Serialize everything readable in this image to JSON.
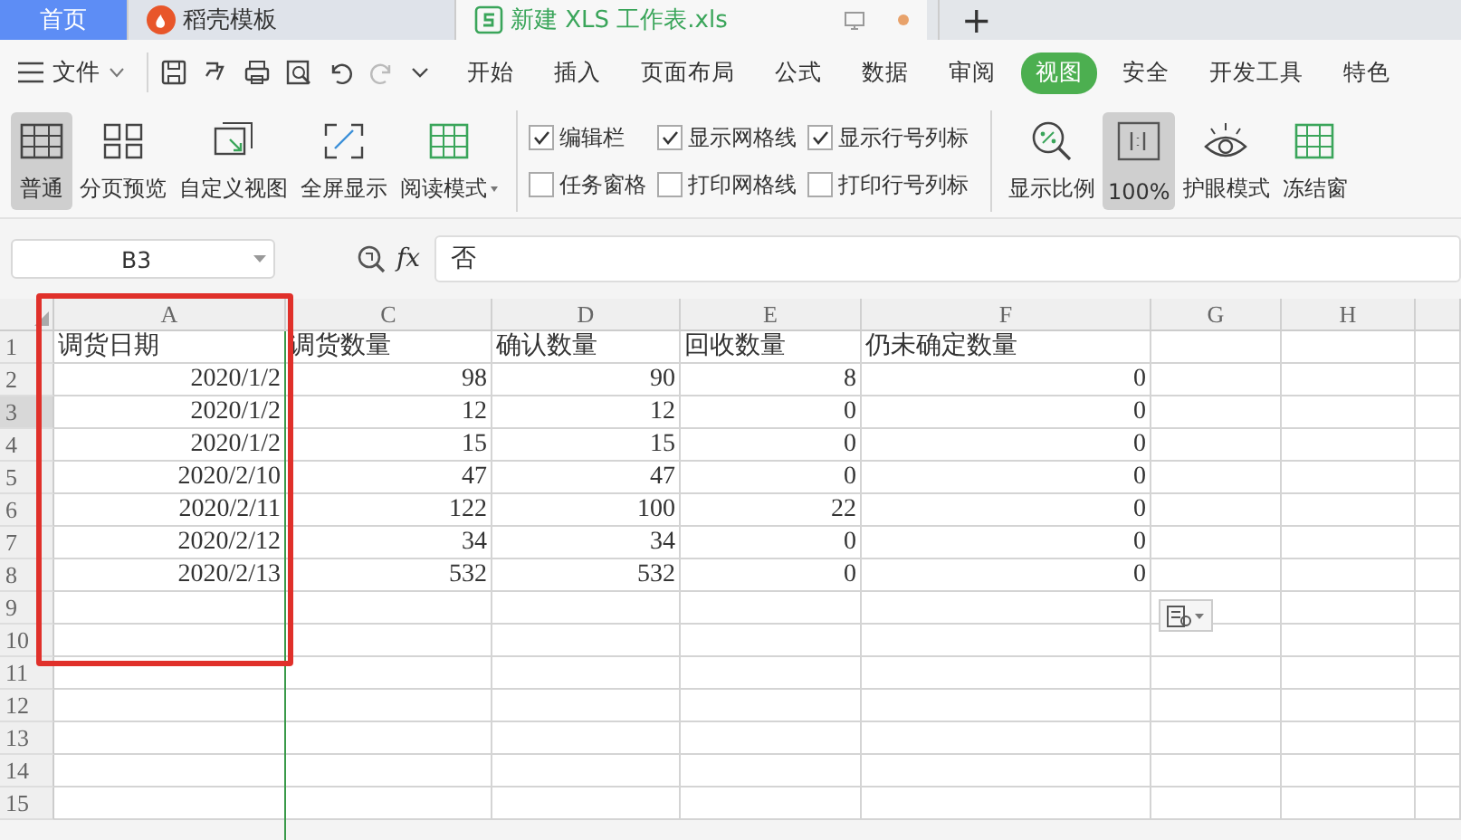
{
  "tabs": [
    {
      "label": "首页",
      "kind": "home",
      "selected": false
    },
    {
      "label": "稻壳模板",
      "kind": "docer",
      "selected": false
    },
    {
      "label": "新建 XLS 工作表.xls",
      "kind": "file",
      "selected": true,
      "modified": true
    }
  ],
  "new_tab_button": "+",
  "file_menu": "文件",
  "menu_tabs": [
    {
      "label": "开始",
      "selected": false
    },
    {
      "label": "插入",
      "selected": false
    },
    {
      "label": "页面布局",
      "selected": false
    },
    {
      "label": "公式",
      "selected": false
    },
    {
      "label": "数据",
      "selected": false
    },
    {
      "label": "审阅",
      "selected": false
    },
    {
      "label": "视图",
      "selected": true
    },
    {
      "label": "安全",
      "selected": false
    },
    {
      "label": "开发工具",
      "selected": false
    },
    {
      "label": "特色",
      "selected": false
    }
  ],
  "view_buttons": [
    {
      "label": "普通",
      "kind": "normal",
      "selected": true
    },
    {
      "label": "分页预览",
      "kind": "pagebreak",
      "selected": false
    },
    {
      "label": "自定义视图",
      "kind": "custom",
      "selected": false
    },
    {
      "label": "全屏显示",
      "kind": "fullscreen",
      "selected": false
    },
    {
      "label": "阅读模式",
      "kind": "reading",
      "selected": false,
      "dropdown": true
    }
  ],
  "checkbox_columns": [
    [
      {
        "label": "编辑栏",
        "checked": true
      },
      {
        "label": "任务窗格",
        "checked": false
      }
    ],
    [
      {
        "label": "显示网格线",
        "checked": true
      },
      {
        "label": "打印网格线",
        "checked": false
      }
    ],
    [
      {
        "label": "显示行号列标",
        "checked": true
      },
      {
        "label": "打印行号列标",
        "checked": false
      }
    ]
  ],
  "zoom_buttons": [
    {
      "label": "显示比例",
      "kind": "zoom",
      "selected": false
    },
    {
      "label": "100%",
      "kind": "actual",
      "selected": true
    },
    {
      "label": "护眼模式",
      "kind": "eye",
      "selected": false
    },
    {
      "label": "冻结窗",
      "kind": "freeze",
      "selected": false
    }
  ],
  "name_box": "B3",
  "formula_label": "fx",
  "formula_value": "否",
  "columns": [
    "A",
    "C",
    "D",
    "E",
    "F",
    "G",
    "H"
  ],
  "rows": [
    {
      "number": "1",
      "selected": false,
      "kind": "text",
      "cells": [
        "调货日期",
        "调货数量",
        "确认数量",
        "回收数量",
        "仍未确定数量"
      ]
    },
    {
      "number": "2",
      "selected": false,
      "kind": "number",
      "cells": [
        "2020/1/2",
        "98",
        "90",
        "8",
        "0"
      ]
    },
    {
      "number": "3",
      "selected": true,
      "kind": "number",
      "cells": [
        "2020/1/2",
        "12",
        "12",
        "0",
        "0"
      ]
    },
    {
      "number": "4",
      "selected": false,
      "kind": "number",
      "cells": [
        "2020/1/2",
        "15",
        "15",
        "0",
        "0"
      ]
    },
    {
      "number": "5",
      "selected": false,
      "kind": "number",
      "cells": [
        "2020/2/10",
        "47",
        "47",
        "0",
        "0"
      ]
    },
    {
      "number": "6",
      "selected": false,
      "kind": "number",
      "cells": [
        "2020/2/11",
        "122",
        "100",
        "22",
        "0"
      ]
    },
    {
      "number": "7",
      "selected": false,
      "kind": "number",
      "cells": [
        "2020/2/12",
        "34",
        "34",
        "0",
        "0"
      ]
    },
    {
      "number": "8",
      "selected": false,
      "kind": "number",
      "cells": [
        "2020/2/13",
        "532",
        "532",
        "0",
        "0"
      ]
    },
    {
      "number": "9",
      "selected": false,
      "kind": "empty",
      "cells": []
    },
    {
      "number": "10",
      "selected": false,
      "kind": "empty",
      "cells": []
    },
    {
      "number": "11",
      "selected": false,
      "kind": "empty",
      "cells": []
    },
    {
      "number": "12",
      "selected": false,
      "kind": "empty",
      "cells": []
    },
    {
      "number": "13",
      "selected": false,
      "kind": "empty",
      "cells": []
    },
    {
      "number": "14",
      "selected": false,
      "kind": "empty",
      "cells": []
    },
    {
      "number": "15",
      "selected": false,
      "kind": "empty",
      "cells": []
    }
  ],
  "highlight_frame": true,
  "paste_options": true
}
